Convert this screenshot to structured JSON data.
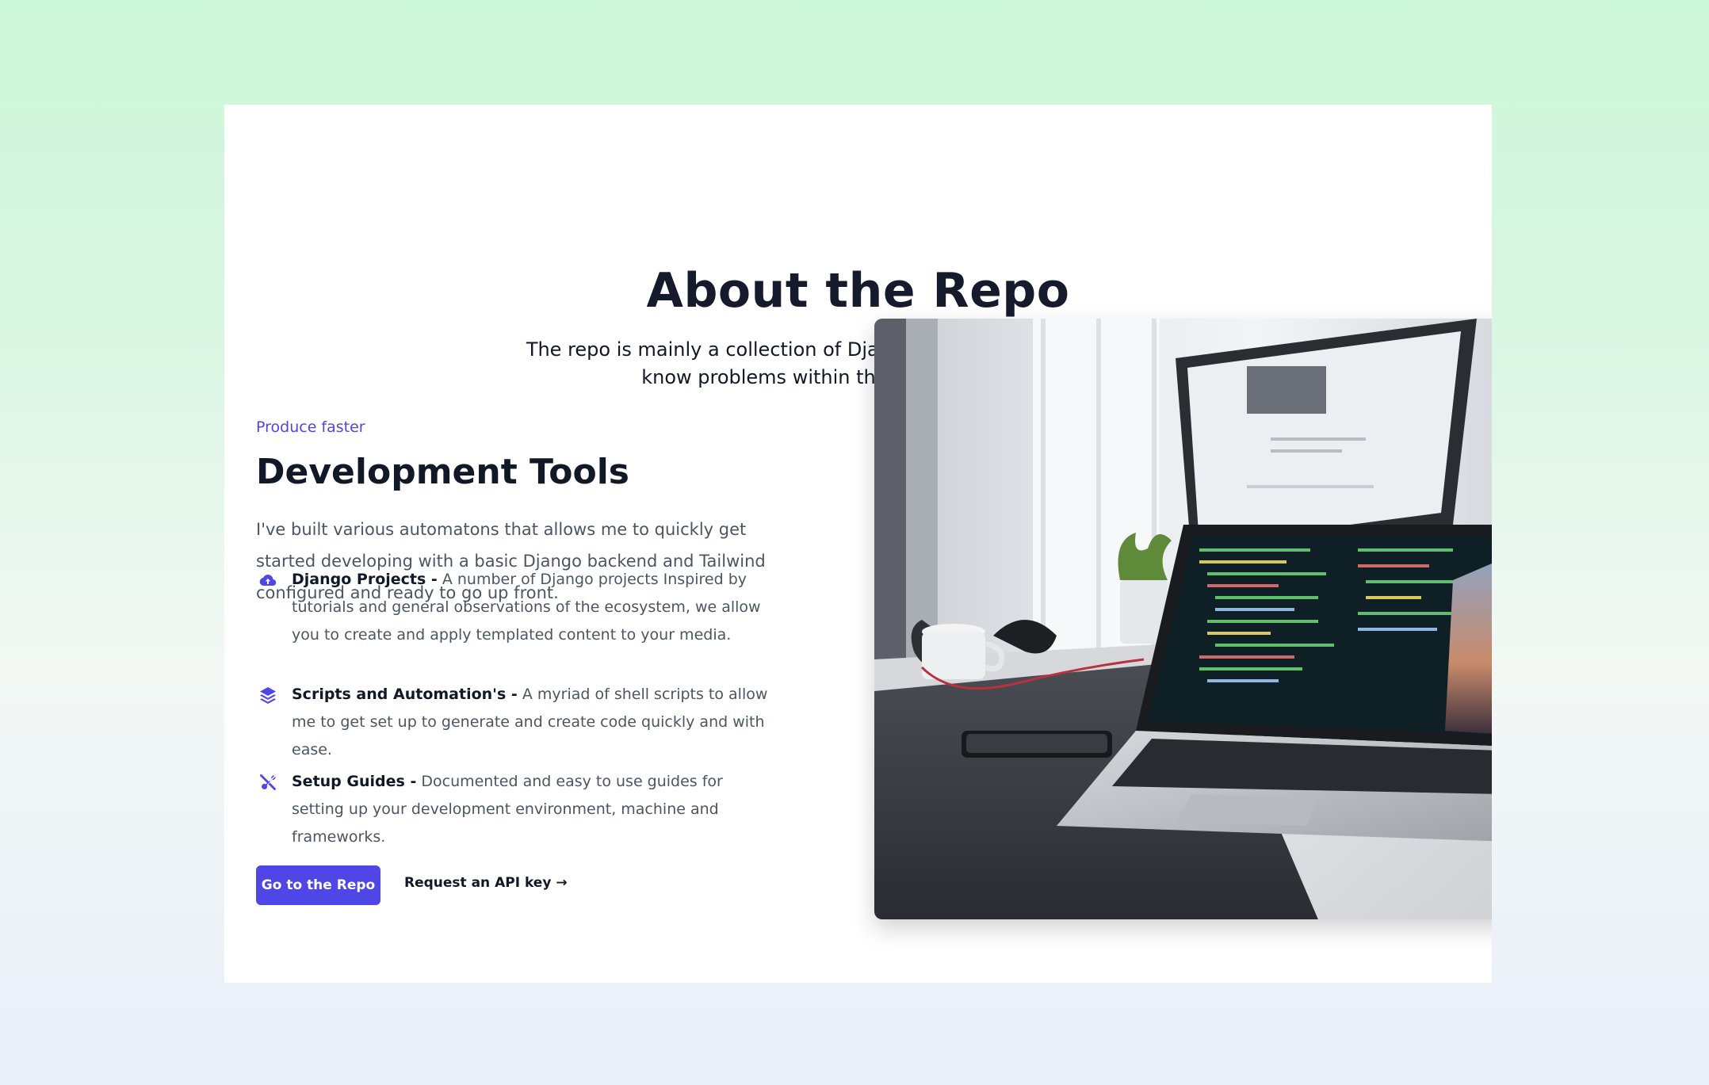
{
  "hero": {
    "title": "About the Repo",
    "subtitle": "The repo is mainly a collection of Django projects and my solutions to know problems within the Django ecosystem."
  },
  "section": {
    "kicker": "Produce faster",
    "title": "Development Tools",
    "description": "I've built various automatons that allows me to quickly get started developing with a basic Django backend and Tailwind configured and ready to go up front."
  },
  "features": [
    {
      "icon": "cloud-upload-icon",
      "title": "Django Projects -",
      "text": " A number of Django projects Inspired by tutorials and general observations of the ecosystem, we allow you to create and apply templated content to your media."
    },
    {
      "icon": "layers-icon",
      "title": "Scripts and Automation's -",
      "text": " A myriad of shell scripts to allow me to get set up to generate and create code quickly and with ease."
    },
    {
      "icon": "tools-icon",
      "title": "Setup Guides -",
      "text": " Documented and easy to use guides for setting up your development environment, machine and frameworks."
    }
  ],
  "actions": {
    "primary": "Go to the Repo",
    "secondary": "Request an API key →"
  },
  "colors": {
    "accent": "#4f46e5",
    "heading": "#111827",
    "body": "#4b5563"
  }
}
